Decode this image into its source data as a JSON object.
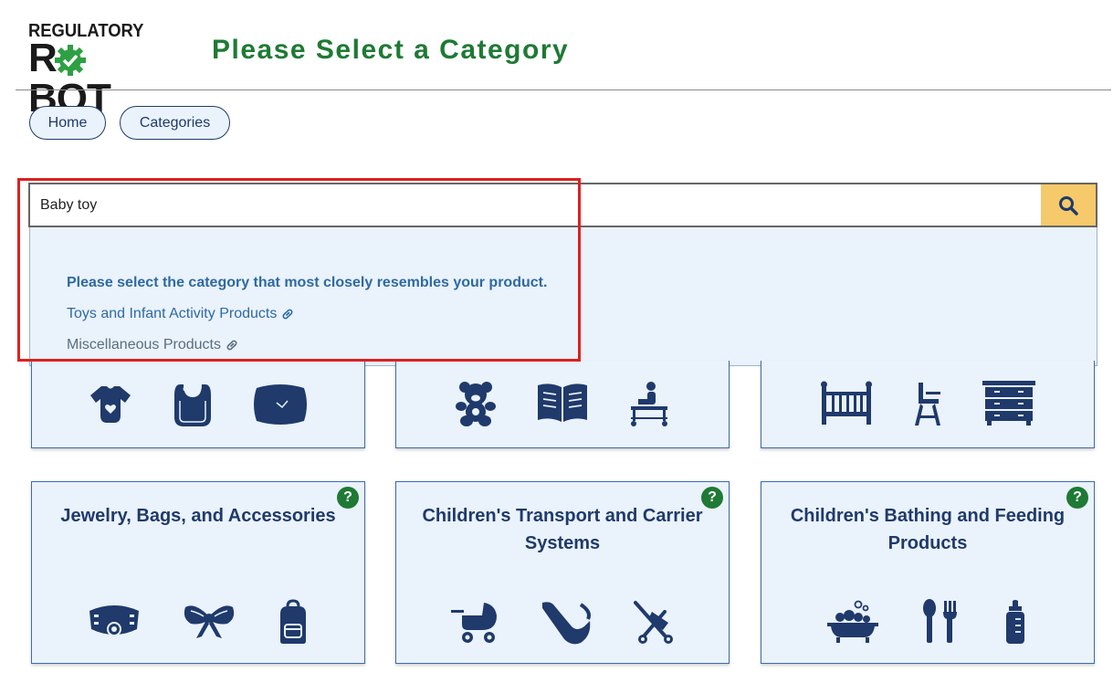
{
  "logo": {
    "line1": "REGULATORY",
    "line2_left": "R",
    "line2_right": "BOT"
  },
  "header": {
    "title": "Please Select a Category"
  },
  "nav": {
    "home": "Home",
    "categories": "Categories"
  },
  "search": {
    "value": "Baby toy",
    "button_icon": "search-icon"
  },
  "dropdown": {
    "prompt": "Please select the category that most closely resembles your product.",
    "results": [
      {
        "label": "Toys and Infant Activity Products",
        "icon": "link-icon"
      },
      {
        "label": "Miscellaneous Products",
        "icon": "link-icon"
      }
    ]
  },
  "cards_top": [
    {
      "icons": [
        "onesie-icon",
        "bib-icon",
        "blanket-icon"
      ]
    },
    {
      "icons": [
        "teddy-bear-icon",
        "book-icon",
        "child-desk-icon"
      ]
    },
    {
      "icons": [
        "crib-icon",
        "high-chair-icon",
        "dresser-icon"
      ]
    }
  ],
  "cards_bottom": [
    {
      "title": "Jewelry, Bags, and Accessories",
      "help": "?",
      "icons": [
        "necklace-icon",
        "bow-icon",
        "backpack-icon"
      ]
    },
    {
      "title": "Children's Transport and Carrier Systems",
      "help": "?",
      "icons": [
        "stroller-icon",
        "car-seat-icon",
        "umbrella-stroller-icon"
      ]
    },
    {
      "title": "Children's Bathing and Feeding Products",
      "help": "?",
      "icons": [
        "bathtub-icon",
        "spoon-fork-icon",
        "baby-bottle-icon"
      ]
    }
  ],
  "colors": {
    "title_green": "#1e7a34",
    "navy": "#1f3a6b",
    "card_bg": "#eaf2fb",
    "search_button": "#f6c96a",
    "highlight": "#dd2020"
  }
}
